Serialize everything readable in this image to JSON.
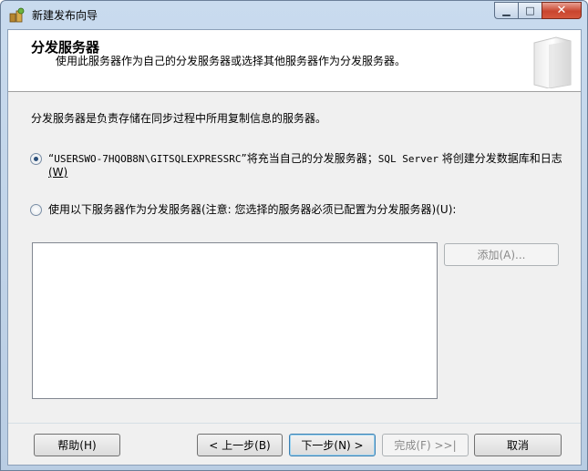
{
  "window": {
    "title": "新建发布向导",
    "minimize_glyph": "▁",
    "maximize_glyph": "□",
    "close_glyph": "✕"
  },
  "header": {
    "title": "分发服务器",
    "subtitle": "使用此服务器作为自己的分发服务器或选择其他服务器作为分发服务器。"
  },
  "description": "分发服务器是负责存储在同步过程中所用复制信息的服务器。",
  "options": {
    "self_distributor": {
      "checked": true,
      "open_quote": "“",
      "server_name": "USERSWO-7HQOB8N\\GITSQLEXPRESSRC",
      "text_after": "”将充当自己的分发服务器；",
      "sql_server": "SQL Server",
      "text_tail": " 将创建分发数据库和日志",
      "accel": "(W)"
    },
    "other_distributor": {
      "checked": false,
      "label": "使用以下服务器作为分发服务器(注意: 您选择的服务器必须已配置为分发服务器)",
      "accel": "(U):"
    }
  },
  "add_button": {
    "label": "添加(A)...",
    "enabled": false
  },
  "footer": {
    "help": "帮助(H)",
    "back": "< 上一步(B)",
    "next": "下一步(N) >",
    "finish": "完成(F) >>|",
    "cancel": "取消"
  }
}
